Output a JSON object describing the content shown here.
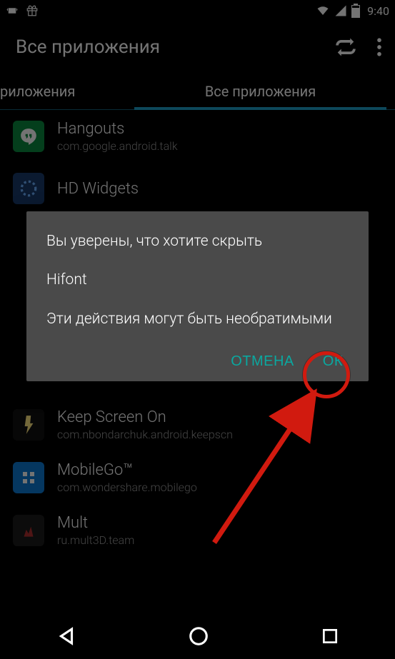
{
  "status": {
    "time": "9:40"
  },
  "appbar": {
    "title": "Все приложения"
  },
  "tabs": {
    "left_label": "риложения",
    "right_label": "Все приложения"
  },
  "apps": [
    {
      "name": "Hangouts",
      "pkg": "com.google.android.talk"
    },
    {
      "name": "HD Widgets",
      "pkg": ""
    },
    {
      "name": "Keep Screen On",
      "pkg": "com.nbondarchuk.android.keepscn"
    },
    {
      "name": "MobileGo™",
      "pkg": "com.wondershare.mobilego"
    },
    {
      "name": "Mult",
      "pkg": "ru.mult3D.team"
    }
  ],
  "dialog": {
    "line1": "Вы уверены, что хотите скрыть",
    "line2": "Hifont",
    "line3": "Эти действия могут быть необратимыми",
    "cancel": "ОТМЕНА",
    "ok": "ОК"
  }
}
